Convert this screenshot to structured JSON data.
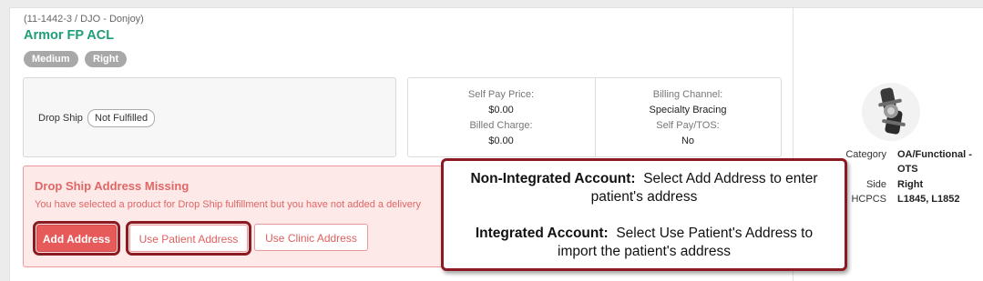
{
  "product": {
    "subtitle": "(11-1442-3 / DJO - Donjoy)",
    "name": "Armor FP ACL",
    "badges": [
      "Medium",
      "Right"
    ]
  },
  "fulfillment": {
    "label": "Drop Ship",
    "status": "Not Fulfilled"
  },
  "pricing": {
    "self_pay_price_label": "Self Pay Price:",
    "self_pay_price": "$0.00",
    "billed_charge_label": "Billed Charge:",
    "billed_charge": "$0.00",
    "billing_channel_label": "Billing Channel:",
    "billing_channel": "Specialty Bracing",
    "self_pay_tos_label": "Self Pay/TOS:",
    "self_pay_tos": "No"
  },
  "alert": {
    "title": "Drop Ship Address Missing",
    "message": "You have selected a product for Drop Ship fulfillment but you have not added a delivery",
    "buttons": {
      "add_address": "Add Address",
      "use_patient_address": "Use Patient Address",
      "use_clinic_address": "Use Clinic Address"
    }
  },
  "callout": {
    "non_integrated_heading": "Non-Integrated Account:",
    "non_integrated_text_1": "Select Add Address to enter",
    "non_integrated_text_2": "patient's address",
    "integrated_heading": "Integrated Account:",
    "integrated_text_1": "Select Use Patient's Address to",
    "integrated_text_2": "import the patient's address"
  },
  "specs": {
    "category_label": "Category",
    "category_value_1": "OA/Functional -",
    "category_value_2": "OTS",
    "side_label": "Side",
    "side_value": "Right",
    "hcpcs_label": "HCPCS",
    "hcpcs_value": "L1845, L1852"
  },
  "colors": {
    "title_green": "#1e9e78",
    "alert_red": "#e06666",
    "button_red": "#e65a5a",
    "callout_border": "#8b1a22"
  },
  "icons": {
    "product_image": "knee-brace-image"
  }
}
